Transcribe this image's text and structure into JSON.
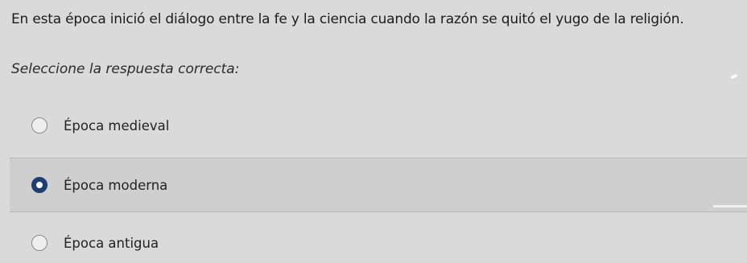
{
  "question": {
    "text": "En esta época inició el diálogo entre la fe y la ciencia cuando la razón se quitó el yugo de la religión.",
    "instruction": "Seleccione la respuesta correcta:"
  },
  "options": [
    {
      "label": "Época medieval",
      "selected": false
    },
    {
      "label": "Época moderna",
      "selected": true
    },
    {
      "label": "Época antigua",
      "selected": false
    }
  ],
  "colors": {
    "selected_radio": "#1f3f73",
    "background": "#dadada"
  }
}
